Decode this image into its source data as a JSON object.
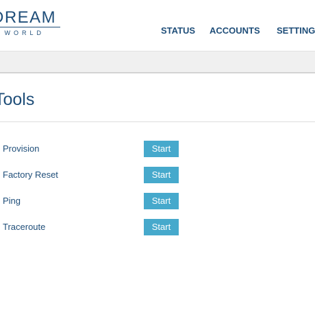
{
  "header": {
    "logo": {
      "main_text": "DREAM",
      "sub_text": "E WORLD"
    },
    "nav": [
      {
        "label": "STATUS"
      },
      {
        "label": "ACCOUNTS"
      },
      {
        "label": "SETTINGS"
      }
    ]
  },
  "main": {
    "title": "Tools",
    "tools": [
      {
        "label": "Provision",
        "button_label": "Start"
      },
      {
        "label": "Factory Reset",
        "button_label": "Start"
      },
      {
        "label": "Ping",
        "button_label": "Start"
      },
      {
        "label": "Traceroute",
        "button_label": "Start"
      }
    ]
  },
  "colors": {
    "brand": "#1f4e79",
    "button": "#46a9cc",
    "subbar": "#f0f0f0"
  }
}
